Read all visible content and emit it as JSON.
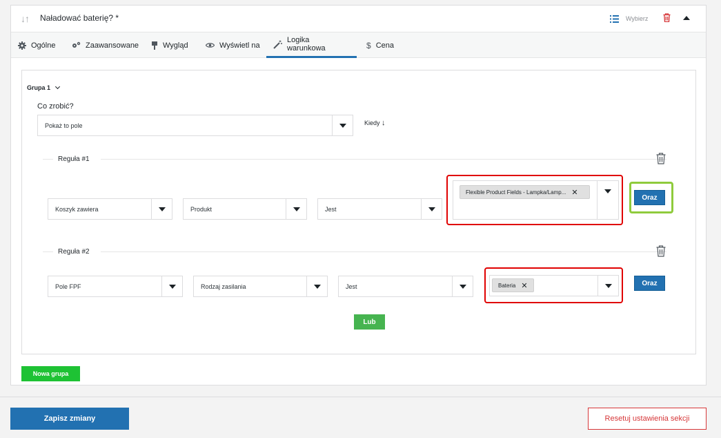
{
  "header": {
    "drag_icon": "sort-arrows-icon",
    "title": "Naładować baterię? *",
    "choose_label": "Wybierz"
  },
  "tabs": [
    {
      "label": "Ogólne",
      "icon": "gear-icon"
    },
    {
      "label": "Zaawansowane",
      "icon": "gears-icon"
    },
    {
      "label": "Wygląd",
      "icon": "brush-icon"
    },
    {
      "label": "Wyświetl na",
      "icon": "eye-icon"
    },
    {
      "label": "Logika warunkowa",
      "icon": "magic-wand-icon",
      "active": true
    },
    {
      "label": "Cena",
      "icon": "dollar-icon"
    }
  ],
  "group": {
    "label": "Grupa 1",
    "what_label": "Co zrobić?",
    "action_value": "Pokaż to pole",
    "when_label": "Kiedy",
    "rules": [
      {
        "title": "Reguła #1",
        "field": "Koszyk zawiera",
        "subject": "Produkt",
        "operator": "Jest",
        "values": [
          "Flexible Product Fields - Lampka/Lamp..."
        ],
        "and_label": "Oraz"
      },
      {
        "title": "Reguła #2",
        "field": "Pole FPF",
        "subject": "Rodzaj zasilania",
        "operator": "Jest",
        "values": [
          "Bateria"
        ],
        "and_label": "Oraz"
      }
    ],
    "or_label": "Lub"
  },
  "new_group_label": "Nowa grupa",
  "footer": {
    "save_label": "Zapisz zmiany",
    "reset_label": "Resetuj ustawienia sekcji"
  },
  "colors": {
    "primary": "#2271b1",
    "green": "#46b450",
    "new_group_green": "#1ec234",
    "danger": "#d63638",
    "highlight_red": "#e00000",
    "highlight_green": "#8fcb3c"
  }
}
